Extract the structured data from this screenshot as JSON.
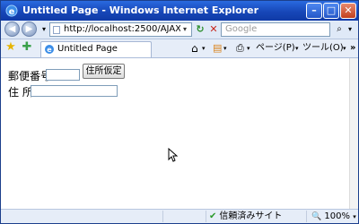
{
  "window": {
    "title": "Untitled Page - Windows Internet Explorer",
    "minimize_glyph": "–",
    "maximize_glyph": "□",
    "close_glyph": "✕"
  },
  "navbar": {
    "url": "http://localhost:2500/AJAXEnabledWebS",
    "search_placeholder": "Google",
    "back_glyph": "◀",
    "forward_glyph": "▶",
    "dropdown_glyph": "▾",
    "refresh_glyph": "↻",
    "stop_glyph": "✕",
    "search_glyph": "⌕",
    "search_dd_glyph": "▾"
  },
  "tabbar": {
    "tab_label": "Untitled Page",
    "page_menu": "ページ(P)",
    "tools_menu": "ツール(O)",
    "more": "»",
    "home_glyph": "⌂",
    "feeds_glyph": "▤",
    "print_glyph": "⎙",
    "menu_dd_glyph": "▾"
  },
  "form": {
    "postal_label": "郵便番号",
    "postal_value": "",
    "address_button": "住所仮定",
    "address_label": "住 所",
    "address_value": ""
  },
  "status": {
    "trusted_text": "信頼済みサイト",
    "check_glyph": "✔",
    "zoom": "100%",
    "zoom_glyph": "🔍"
  },
  "colors": {
    "titlebar": "#1747b8",
    "chrome_bg": "#e6edf8",
    "star": "#e6b400",
    "check": "#2a9a2a"
  }
}
